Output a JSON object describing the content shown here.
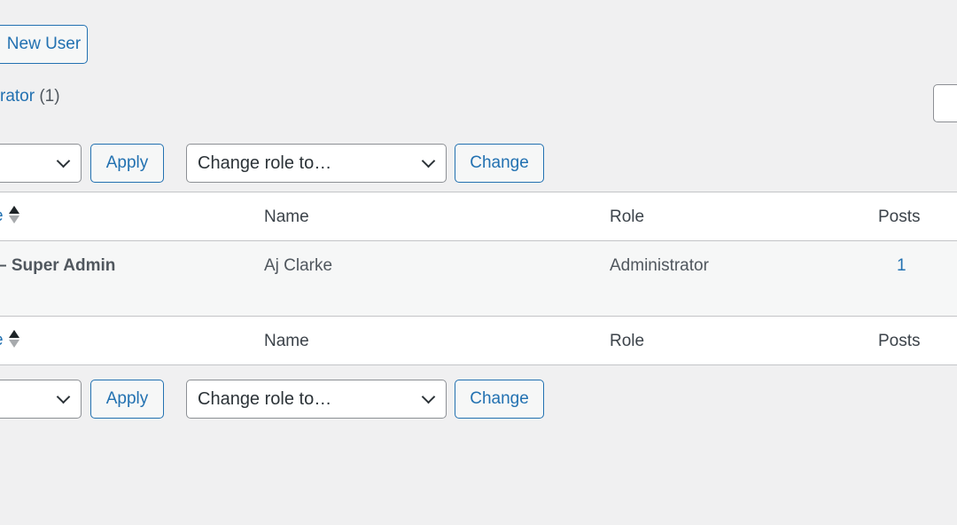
{
  "header": {
    "add_new_label": "New User"
  },
  "filters": {
    "role_link": "rator",
    "role_count": "(1)"
  },
  "search": {
    "value": ""
  },
  "bulk_top": {
    "apply_label": "Apply",
    "change_role_placeholder": "Change role to…",
    "change_label": "Change"
  },
  "bulk_bottom": {
    "apply_label": "Apply",
    "change_role_placeholder": "Change role to…",
    "change_label": "Change"
  },
  "table": {
    "columns": {
      "username": "e",
      "name": "Name",
      "role": "Role",
      "posts": "Posts"
    },
    "rows": [
      {
        "username_suffix": "– Super Admin",
        "name": "Aj Clarke",
        "role": "Administrator",
        "posts": "1"
      }
    ]
  },
  "colors": {
    "accent": "#2271b1",
    "background": "#f0f0f1"
  }
}
